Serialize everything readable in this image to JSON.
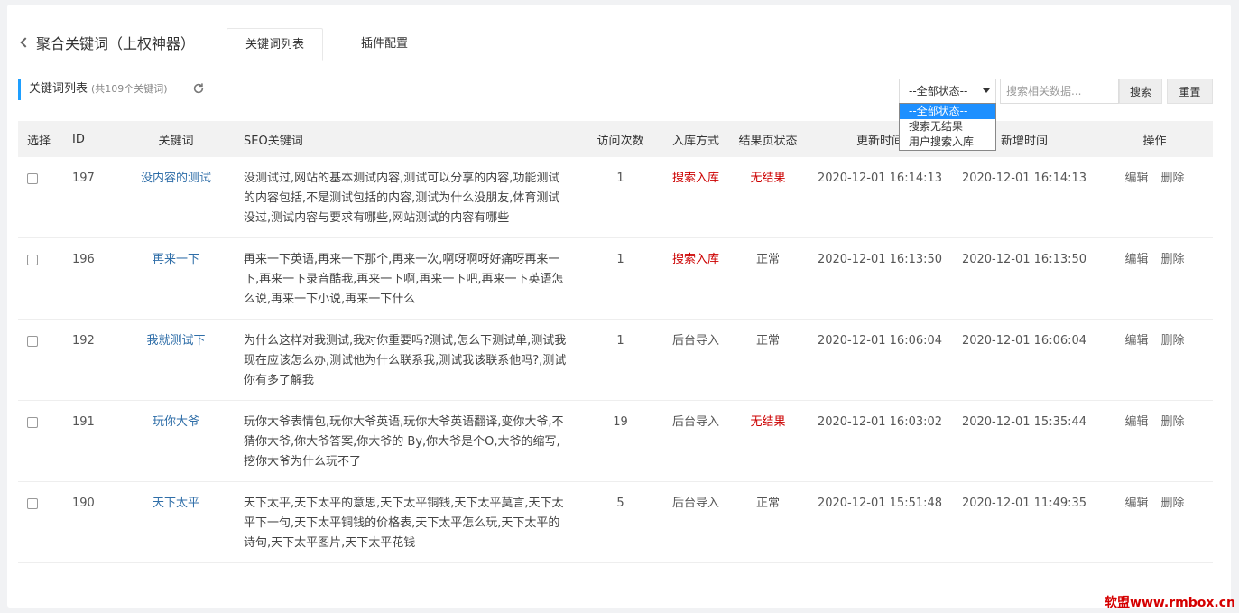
{
  "header": {
    "back_title": "聚合关键词（上权神器）",
    "tabs": [
      {
        "label": "关键词列表",
        "active": true
      },
      {
        "label": "插件配置",
        "active": false
      }
    ]
  },
  "toolbar": {
    "section_title": "关键词列表",
    "count_text": "(共109个关键词)",
    "refresh_icon": "refresh-icon",
    "filter_selected": "--全部状态--",
    "filter_options": [
      "--全部状态--",
      "搜索无结果",
      "用户搜索入库"
    ],
    "search_placeholder": "搜索相关数据...",
    "search_label": "搜索",
    "reset_label": "重置"
  },
  "table": {
    "headers": [
      "选择",
      "ID",
      "关键词",
      "SEO关键词",
      "访问次数",
      "入库方式",
      "结果页状态",
      "更新时间",
      "新增时间",
      "操作"
    ],
    "rows": [
      {
        "id": "197",
        "keyword": "没内容的测试",
        "seo": "没测试过,网站的基本测试内容,测试可以分享的内容,功能测试的内容包括,不是测试包括的内容,测试为什么没朋友,体育测试没过,测试内容与要求有哪些,网站测试的内容有哪些",
        "visits": "1",
        "source": "搜索入库",
        "source_red": true,
        "status": "无结果",
        "status_red": true,
        "updated": "2020-12-01 16:14:13",
        "created": "2020-12-01 16:14:13",
        "edit": "编辑",
        "delete": "删除"
      },
      {
        "id": "196",
        "keyword": "再来一下",
        "seo": "再来一下英语,再来一下那个,再来一次,啊呀啊呀好痛呀再来一下,再来一下录音酷我,再来一下啊,再来一下吧,再来一下英语怎么说,再来一下小说,再来一下什么",
        "visits": "1",
        "source": "搜索入库",
        "source_red": true,
        "status": "正常",
        "status_red": false,
        "updated": "2020-12-01 16:13:50",
        "created": "2020-12-01 16:13:50",
        "edit": "编辑",
        "delete": "删除"
      },
      {
        "id": "192",
        "keyword": "我就测试下",
        "seo": "为什么这样对我测试,我对你重要吗?测试,怎么下测试单,测试我现在应该怎么办,测试他为什么联系我,测试我该联系他吗?,测试你有多了解我",
        "visits": "1",
        "source": "后台导入",
        "source_red": false,
        "status": "正常",
        "status_red": false,
        "updated": "2020-12-01 16:06:04",
        "created": "2020-12-01 16:06:04",
        "edit": "编辑",
        "delete": "删除"
      },
      {
        "id": "191",
        "keyword": "玩你大爷",
        "seo": "玩你大爷表情包,玩你大爷英语,玩你大爷英语翻译,变你大爷,不猜你大爷,你大爷答案,你大爷的 By,你大爷是个O,大爷的缩写,挖你大爷为什么玩不了",
        "visits": "19",
        "source": "后台导入",
        "source_red": false,
        "status": "无结果",
        "status_red": true,
        "updated": "2020-12-01 16:03:02",
        "created": "2020-12-01 15:35:44",
        "edit": "编辑",
        "delete": "删除"
      },
      {
        "id": "190",
        "keyword": "天下太平",
        "seo": "天下太平,天下太平的意思,天下太平铜钱,天下太平莫言,天下太平下一句,天下太平铜钱的价格表,天下太平怎么玩,天下太平的诗句,天下太平图片,天下太平花钱",
        "visits": "5",
        "source": "后台导入",
        "source_red": false,
        "status": "正常",
        "status_red": false,
        "updated": "2020-12-01 15:51:48",
        "created": "2020-12-01 11:49:35",
        "edit": "编辑",
        "delete": "删除"
      }
    ]
  },
  "watermark": "软盟www.rmbox.cn",
  "colors": {
    "accent": "#1e9fff",
    "danger": "#c00000",
    "link": "#2f6ea8"
  }
}
